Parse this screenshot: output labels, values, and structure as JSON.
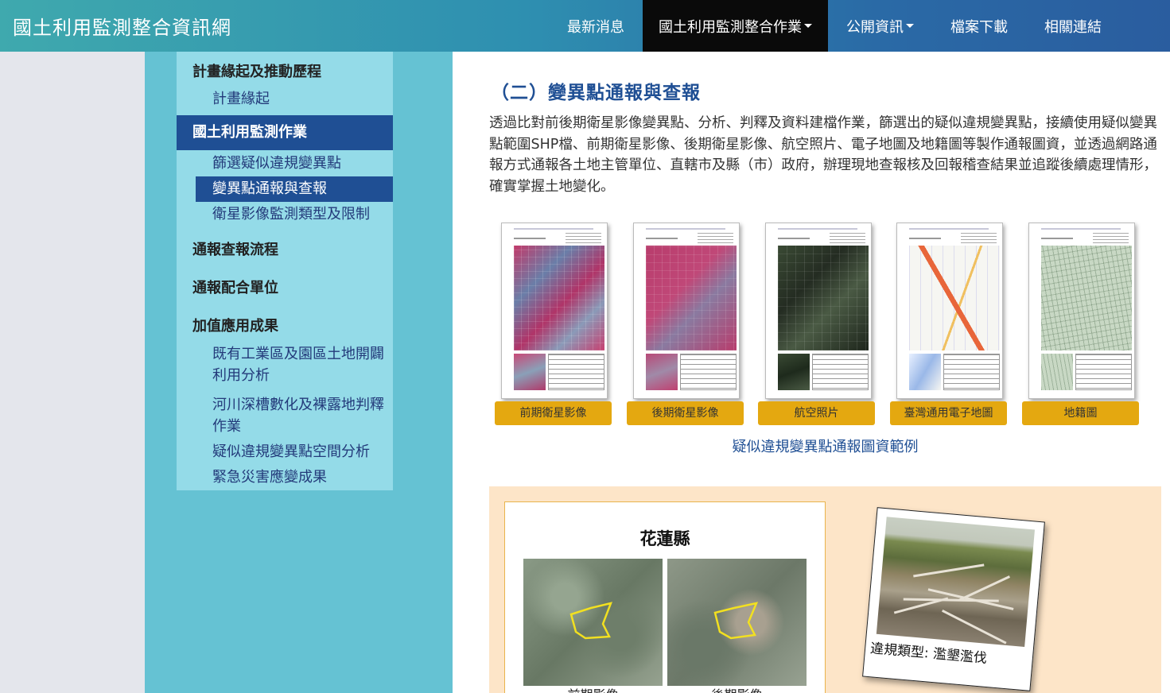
{
  "header": {
    "title": "國土利用監測整合資訊網",
    "nav": [
      {
        "label": "最新消息",
        "dropdown": false
      },
      {
        "label": "國土利用監測整合作業",
        "dropdown": true,
        "active": true
      },
      {
        "label": "公開資訊",
        "dropdown": true
      },
      {
        "label": "檔案下載",
        "dropdown": false
      },
      {
        "label": "相關連結",
        "dropdown": false
      }
    ]
  },
  "sidebar": {
    "sections": [
      {
        "heading": "計畫緣起及推動歷程",
        "items": [
          "計畫緣起"
        ]
      },
      {
        "heading": "國土利用監測作業",
        "items": [
          "篩選疑似違規變異點",
          "變異點通報與查報",
          "衛星影像監測類型及限制"
        ]
      },
      {
        "heading": "通報查報流程",
        "items": []
      },
      {
        "heading": "通報配合單位",
        "items": []
      },
      {
        "heading": "加值應用成果",
        "items": [
          "既有工業區及園區土地開闢利用分析",
          "河川深槽數化及裸露地判釋作業",
          "疑似違規變異點空間分析",
          "緊急災害應變成果"
        ]
      }
    ],
    "active_heading": "國土利用監測作業",
    "active_item": "變異點通報與查報"
  },
  "main": {
    "section_title": "（二）變異點通報與查報",
    "paragraph": "透過比對前後期衛星影像變異點、分析、判釋及資料建檔作業，篩選出的疑似違規變異點，接續使用疑似變異點範圍SHP檔、前期衛星影像、後期衛星影像、航空照片、電子地圖及地籍圖等製作通報圖資，並透過網路通報方式通報各土地主管單位、直轄市及縣（市）政府，辦理現地查報核及回報稽查結果並追蹤後續處理情形，確實掌握土地變化。",
    "thumbnails": [
      "前期衛星影像",
      "後期衛星影像",
      "航空照片",
      "臺灣通用電子地圖",
      "地籍圖"
    ],
    "thumbnails_caption": "疑似違規變異點通報圖資範例",
    "example": {
      "county": "花蓮縣",
      "before_label": "前期影像",
      "after_label": "後期影像",
      "photo_caption": "違規類型: 濫墾濫伐"
    }
  },
  "colors": {
    "nav_gradient_start": "#3fa9ae",
    "nav_gradient_end": "#2a5d9f",
    "active_blue": "#1f4f94",
    "sidebar_bg": "#94dbe8",
    "left_column_bg": "#65c2d3",
    "label_orange": "#e4a810",
    "peach_bg": "#fde5c8"
  }
}
